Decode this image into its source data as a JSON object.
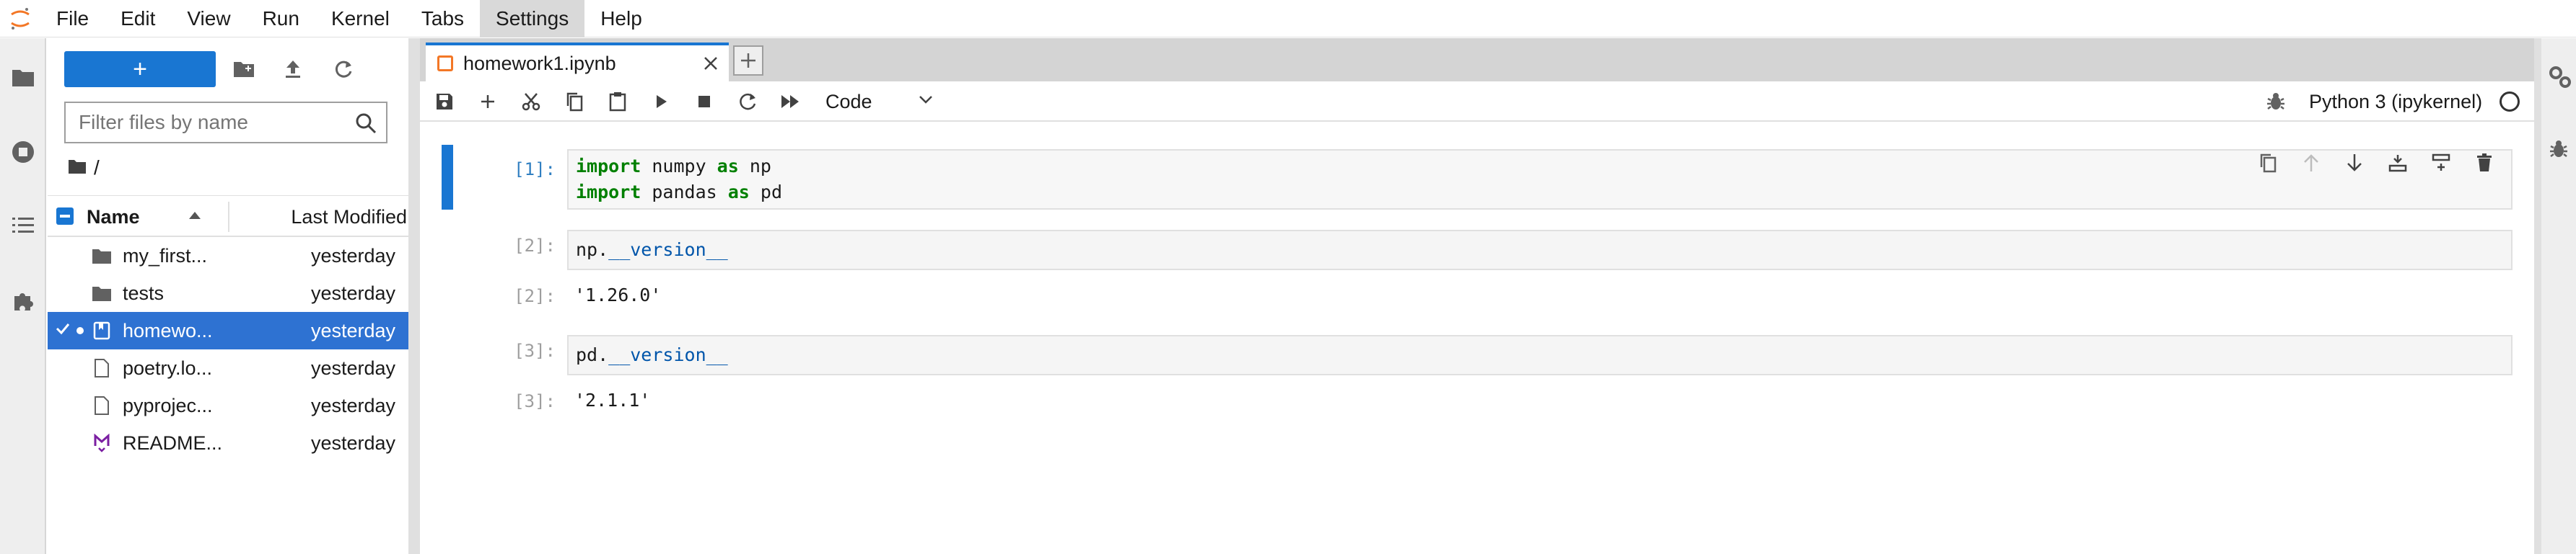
{
  "colors": {
    "accent": "#1976d2",
    "selected_row": "#2e72d2",
    "jupyter_orange": "#f37726",
    "keyword": "#008000",
    "prompt_active": "#307fc1"
  },
  "menubar": {
    "items": [
      {
        "label": "File"
      },
      {
        "label": "Edit"
      },
      {
        "label": "View"
      },
      {
        "label": "Run"
      },
      {
        "label": "Kernel"
      },
      {
        "label": "Tabs"
      },
      {
        "label": "Settings"
      },
      {
        "label": "Help"
      }
    ],
    "active": "Settings"
  },
  "left_rail": {
    "icons": [
      "folder-icon",
      "running-icon",
      "toc-icon",
      "extensions-icon"
    ]
  },
  "filebrowser": {
    "new_button_label": "+",
    "filter_placeholder": "Filter files by name",
    "breadcrumb": "/",
    "header": {
      "name": "Name",
      "modified": "Last Modified"
    },
    "files": [
      {
        "name": "my_first...",
        "modified": "yesterday",
        "icon": "folder-icon",
        "selected": false
      },
      {
        "name": "tests",
        "modified": "yesterday",
        "icon": "folder-icon",
        "selected": false
      },
      {
        "name": "homewo...",
        "modified": "yesterday",
        "icon": "notebook-icon",
        "selected": true
      },
      {
        "name": "poetry.lo...",
        "modified": "yesterday",
        "icon": "file-icon",
        "selected": false
      },
      {
        "name": "pyprojec...",
        "modified": "yesterday",
        "icon": "file-icon",
        "selected": false
      },
      {
        "name": "README...",
        "modified": "yesterday",
        "icon": "markdown-icon",
        "selected": false
      }
    ]
  },
  "tab": {
    "label": "homework1.ipynb"
  },
  "toolbar": {
    "cell_type": "Code",
    "kernel": "Python 3 (ipykernel)"
  },
  "cells": [
    {
      "prompt": "[1]:",
      "lines": [
        [
          {
            "t": "import",
            "k": true
          },
          {
            "t": " numpy "
          },
          {
            "t": "as",
            "k": true
          },
          {
            "t": " np"
          }
        ],
        [
          {
            "t": "import",
            "k": true
          },
          {
            "t": " pandas "
          },
          {
            "t": "as",
            "k": true
          },
          {
            "t": " pd"
          }
        ]
      ],
      "output_prompt": "",
      "output": ""
    },
    {
      "prompt": "[2]:",
      "code_obj": "np.",
      "code_attr": "__version__",
      "output_prompt": "[2]:",
      "output": "'1.26.0'"
    },
    {
      "prompt": "[3]:",
      "code_obj": "pd.",
      "code_attr": "__version__",
      "output_prompt": "[3]:",
      "output": "'2.1.1'"
    }
  ]
}
